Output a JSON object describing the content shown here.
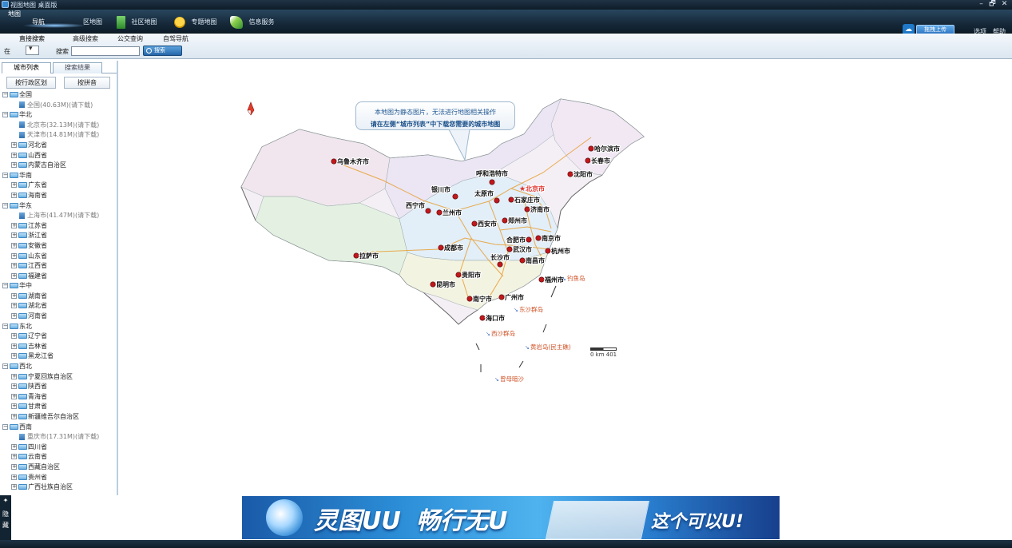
{
  "window": {
    "title": "视图地图 桌面版",
    "controls": [
      "–",
      "🗗",
      "✕"
    ]
  },
  "toolbar": {
    "logo_label": "地图",
    "nav": [
      {
        "label": "导航",
        "icon": "navigation-icon"
      },
      {
        "label": "区地图",
        "icon": "region-map-icon"
      },
      {
        "label": "社区地图",
        "icon": "building-icon"
      },
      {
        "label": "专题地图",
        "icon": "smiley-icon"
      },
      {
        "label": "信息服务",
        "icon": "feather-icon"
      }
    ],
    "upload_label": "拖拽上传",
    "options_label": "选项",
    "help_label": "帮助"
  },
  "search": {
    "tabs": [
      "直接搜索",
      "高级搜索",
      "公交查询",
      "自驾导航"
    ],
    "in_label": "在",
    "search_label": "搜索",
    "input_value": "",
    "button_label": "搜索"
  },
  "sidebar": {
    "tabs": [
      "城市列表",
      "搜索结果"
    ],
    "sort_buttons": [
      "按行政区划",
      "按拼音"
    ],
    "tree": [
      {
        "label": "全国",
        "level": 0,
        "type": "folder",
        "open": true
      },
      {
        "label": "全国(40.63M)(请下载)",
        "level": 2,
        "type": "doc"
      },
      {
        "label": "华北",
        "level": 0,
        "type": "folder",
        "open": true
      },
      {
        "label": "北京市(32.13M)(请下载)",
        "level": 2,
        "type": "doc"
      },
      {
        "label": "天津市(14.81M)(请下载)",
        "level": 2,
        "type": "doc"
      },
      {
        "label": "河北省",
        "level": 1,
        "type": "folder"
      },
      {
        "label": "山西省",
        "level": 1,
        "type": "folder"
      },
      {
        "label": "内蒙古自治区",
        "level": 1,
        "type": "folder"
      },
      {
        "label": "华南",
        "level": 0,
        "type": "folder",
        "open": true
      },
      {
        "label": "广东省",
        "level": 1,
        "type": "folder"
      },
      {
        "label": "海南省",
        "level": 1,
        "type": "folder"
      },
      {
        "label": "华东",
        "level": 0,
        "type": "folder",
        "open": true
      },
      {
        "label": "上海市(41.47M)(请下载)",
        "level": 2,
        "type": "doc"
      },
      {
        "label": "江苏省",
        "level": 1,
        "type": "folder"
      },
      {
        "label": "浙江省",
        "level": 1,
        "type": "folder"
      },
      {
        "label": "安徽省",
        "level": 1,
        "type": "folder"
      },
      {
        "label": "山东省",
        "level": 1,
        "type": "folder"
      },
      {
        "label": "江西省",
        "level": 1,
        "type": "folder"
      },
      {
        "label": "福建省",
        "level": 1,
        "type": "folder"
      },
      {
        "label": "华中",
        "level": 0,
        "type": "folder",
        "open": true
      },
      {
        "label": "湖南省",
        "level": 1,
        "type": "folder"
      },
      {
        "label": "湖北省",
        "level": 1,
        "type": "folder"
      },
      {
        "label": "河南省",
        "level": 1,
        "type": "folder"
      },
      {
        "label": "东北",
        "level": 0,
        "type": "folder",
        "open": true
      },
      {
        "label": "辽宁省",
        "level": 1,
        "type": "folder"
      },
      {
        "label": "吉林省",
        "level": 1,
        "type": "folder"
      },
      {
        "label": "黑龙江省",
        "level": 1,
        "type": "folder"
      },
      {
        "label": "西北",
        "level": 0,
        "type": "folder",
        "open": true
      },
      {
        "label": "宁夏回族自治区",
        "level": 1,
        "type": "folder"
      },
      {
        "label": "陕西省",
        "level": 1,
        "type": "folder"
      },
      {
        "label": "青海省",
        "level": 1,
        "type": "folder"
      },
      {
        "label": "甘肃省",
        "level": 1,
        "type": "folder"
      },
      {
        "label": "新疆维吾尔自治区",
        "level": 1,
        "type": "folder"
      },
      {
        "label": "西南",
        "level": 0,
        "type": "folder",
        "open": true
      },
      {
        "label": "重庆市(17.31M)(请下载)",
        "level": 2,
        "type": "doc"
      },
      {
        "label": "四川省",
        "level": 1,
        "type": "folder"
      },
      {
        "label": "云南省",
        "level": 1,
        "type": "folder"
      },
      {
        "label": "西藏自治区",
        "level": 1,
        "type": "folder"
      },
      {
        "label": "贵州省",
        "level": 1,
        "type": "folder"
      },
      {
        "label": "广西壮族自治区",
        "level": 1,
        "type": "folder"
      }
    ],
    "hide_label": "隐藏"
  },
  "map": {
    "callout_line1": "本地图为静态图片，无法进行地图相关操作",
    "callout_line2": "请在左侧“城市列表”中下载您需要的城市地图",
    "cities": [
      {
        "name": "乌鲁木齐市",
        "capital": false
      },
      {
        "name": "哈尔滨市",
        "capital": false
      },
      {
        "name": "长春市",
        "capital": false
      },
      {
        "name": "沈阳市",
        "capital": false
      },
      {
        "name": "呼和浩特市",
        "capital": false
      },
      {
        "name": "北京市",
        "capital": true
      },
      {
        "name": "银川市",
        "capital": false
      },
      {
        "name": "太原市",
        "capital": false
      },
      {
        "name": "石家庄市",
        "capital": false
      },
      {
        "name": "济南市",
        "capital": false
      },
      {
        "name": "西宁市",
        "capital": false
      },
      {
        "name": "兰州市",
        "capital": false
      },
      {
        "name": "西安市",
        "capital": false
      },
      {
        "name": "郑州市",
        "capital": false
      },
      {
        "name": "合肥市",
        "capital": false
      },
      {
        "name": "南京市",
        "capital": false
      },
      {
        "name": "拉萨市",
        "capital": false
      },
      {
        "name": "成都市",
        "capital": false
      },
      {
        "name": "武汉市",
        "capital": false
      },
      {
        "name": "杭州市",
        "capital": false
      },
      {
        "name": "长沙市",
        "capital": false
      },
      {
        "name": "南昌市",
        "capital": false
      },
      {
        "name": "贵阳市",
        "capital": false
      },
      {
        "name": "福州市",
        "capital": false
      },
      {
        "name": "昆明市",
        "capital": false
      },
      {
        "name": "南宁市",
        "capital": false
      },
      {
        "name": "广州市",
        "capital": false
      },
      {
        "name": "海口市",
        "capital": false
      }
    ],
    "islands": [
      "钓鱼岛",
      "东沙群岛",
      "西沙群岛",
      "黄岩岛(民主礁)",
      "曾母暗沙"
    ],
    "scale_label": "0 km 401",
    "compass_label": "N"
  },
  "ad": {
    "brand": "灵图UU",
    "slogan": "畅行无U",
    "cta": "这个可以U!"
  },
  "colors": {
    "chrome_dark": "#16293a",
    "accent_blue": "#2d73c0",
    "city_marker": "#c0181c",
    "capital_label": "#e0302a",
    "island_label": "#d0552a"
  }
}
